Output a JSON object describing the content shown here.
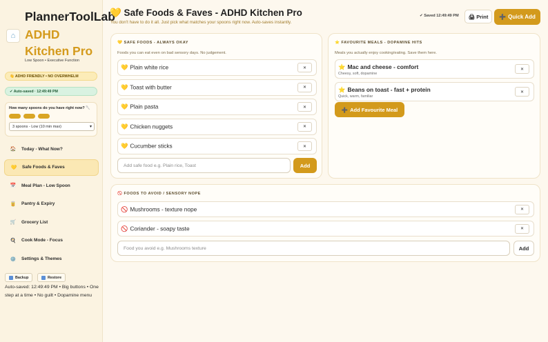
{
  "sidebar": {
    "app_name": "PlannerToolLab",
    "product_name": "ADHD Kitchen Pro",
    "tagline": "Low Spoon • Executive Function",
    "badge_adhd": "👋 ADHD FRIENDLY • NO OVERWHELM",
    "badge_saved": "✔ Auto-saved · 12:49:49 PM",
    "spoon_question": "How many spoons do you have right now? 🥄",
    "spoon_count": 3,
    "spoon_selected": "3 spoons - Low (10 min max)",
    "nav": [
      {
        "icon": "🏠",
        "label": "Today - What Now?"
      },
      {
        "icon": "💛",
        "label": "Safe Foods & Faves"
      },
      {
        "icon": "📅",
        "label": "Meal Plan - Low Spoon"
      },
      {
        "icon": "🥫",
        "label": "Pantry & Expiry"
      },
      {
        "icon": "🛒",
        "label": "Grocery List"
      },
      {
        "icon": "🍳",
        "label": "Cook Mode - Focus"
      },
      {
        "icon": "⚙️",
        "label": "Settings & Themes"
      }
    ],
    "active_nav": 1,
    "backup_label": "Backup",
    "restore_label": "Restore",
    "footer": "Auto-saved: 12:49:49 PM • Big buttons • One step at a time • No guilt • Dopamine menu"
  },
  "header": {
    "title": "💛 Safe Foods & Faves - ADHD Kitchen Pro",
    "subtitle": "You don't have to do it all. Just pick what matches your spoons right now. Auto-saves instantly.",
    "saved": "✔ Saved 12:49:49 PM",
    "print_label": "🖨 Print",
    "quick_add_label": "Quick Add"
  },
  "safe_foods": {
    "heading": "💛 SAFE FOODS - ALWAYS OKAY",
    "description": "Foods you can eat even on bad sensory days. No judgement.",
    "items": [
      "Plain white rice",
      "Toast with butter",
      "Plain pasta",
      "Chicken nuggets",
      "Cucumber sticks"
    ],
    "input_placeholder": "Add safe food e.g. Plain rice, Toast",
    "add_label": "Add",
    "remove_label": "✕"
  },
  "favourites": {
    "heading": "⭐ FAVOURITE MEALS - DOPAMINE HITS",
    "description": "Meals you actually enjoy cooking/eating. Save them here.",
    "items": [
      {
        "title": "Mac and cheese - comfort",
        "note": "Cheesy, soft, dopamine"
      },
      {
        "title": "Beans on toast - fast + protein",
        "note": "Quick, warm, familiar"
      }
    ],
    "add_label": "Add Favourite Meal"
  },
  "avoid": {
    "heading": "🚫 FOODS TO AVOID / SENSORY NOPE",
    "items": [
      "Mushrooms - texture nope",
      "Coriander - soapy taste"
    ],
    "input_placeholder": "Food you avoid e.g. Mushrooms texture",
    "add_label": "Add"
  }
}
